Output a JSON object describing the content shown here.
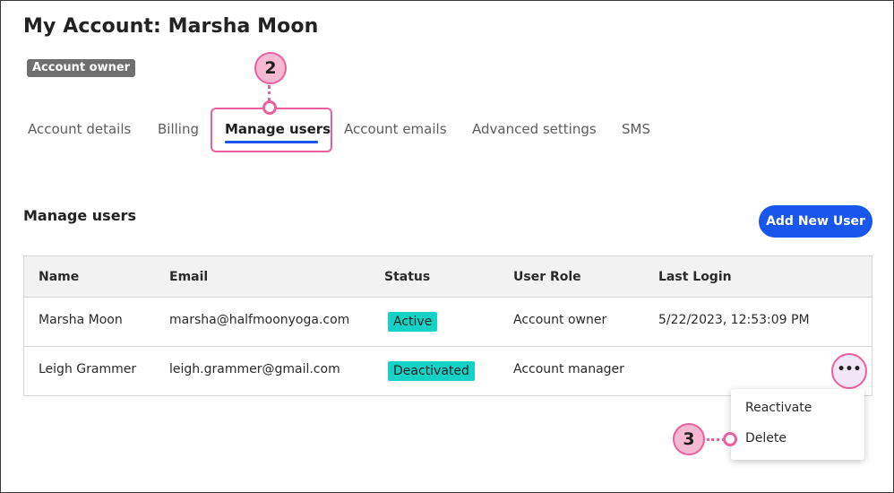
{
  "page": {
    "title": "My Account: Marsha Moon",
    "role_badge": "Account owner"
  },
  "tabs": [
    {
      "label": "Account details",
      "active": false
    },
    {
      "label": "Billing",
      "active": false
    },
    {
      "label": "Manage users",
      "active": true
    },
    {
      "label": "Account emails",
      "active": false
    },
    {
      "label": "Advanced settings",
      "active": false
    },
    {
      "label": "SMS",
      "active": false
    }
  ],
  "section": {
    "heading": "Manage users",
    "add_button_label": "Add New User"
  },
  "table": {
    "columns": [
      "Name",
      "Email",
      "Status",
      "User Role",
      "Last Login"
    ],
    "rows": [
      {
        "name": "Marsha Moon",
        "email": "marsha@halfmoonyoga.com",
        "status": "Active",
        "role": "Account owner",
        "last_login": "5/22/2023, 12:53:09 PM"
      },
      {
        "name": "Leigh Grammer",
        "email": "leigh.grammer@gmail.com",
        "status": "Deactivated",
        "role": "Account manager",
        "last_login": ""
      }
    ]
  },
  "row_menu": {
    "trigger_label": "•••",
    "items": [
      "Reactivate",
      "Delete"
    ]
  },
  "callouts": [
    "2",
    "3"
  ],
  "colors": {
    "accent_blue": "#1856ed",
    "callout_pink": "#ec5f9e",
    "callout_fill": "#f6b9d4",
    "status_teal": "#14d3c6",
    "badge_gray": "#6f6f6f"
  },
  "icons": {
    "more_options": "more-horizontal-icon"
  }
}
